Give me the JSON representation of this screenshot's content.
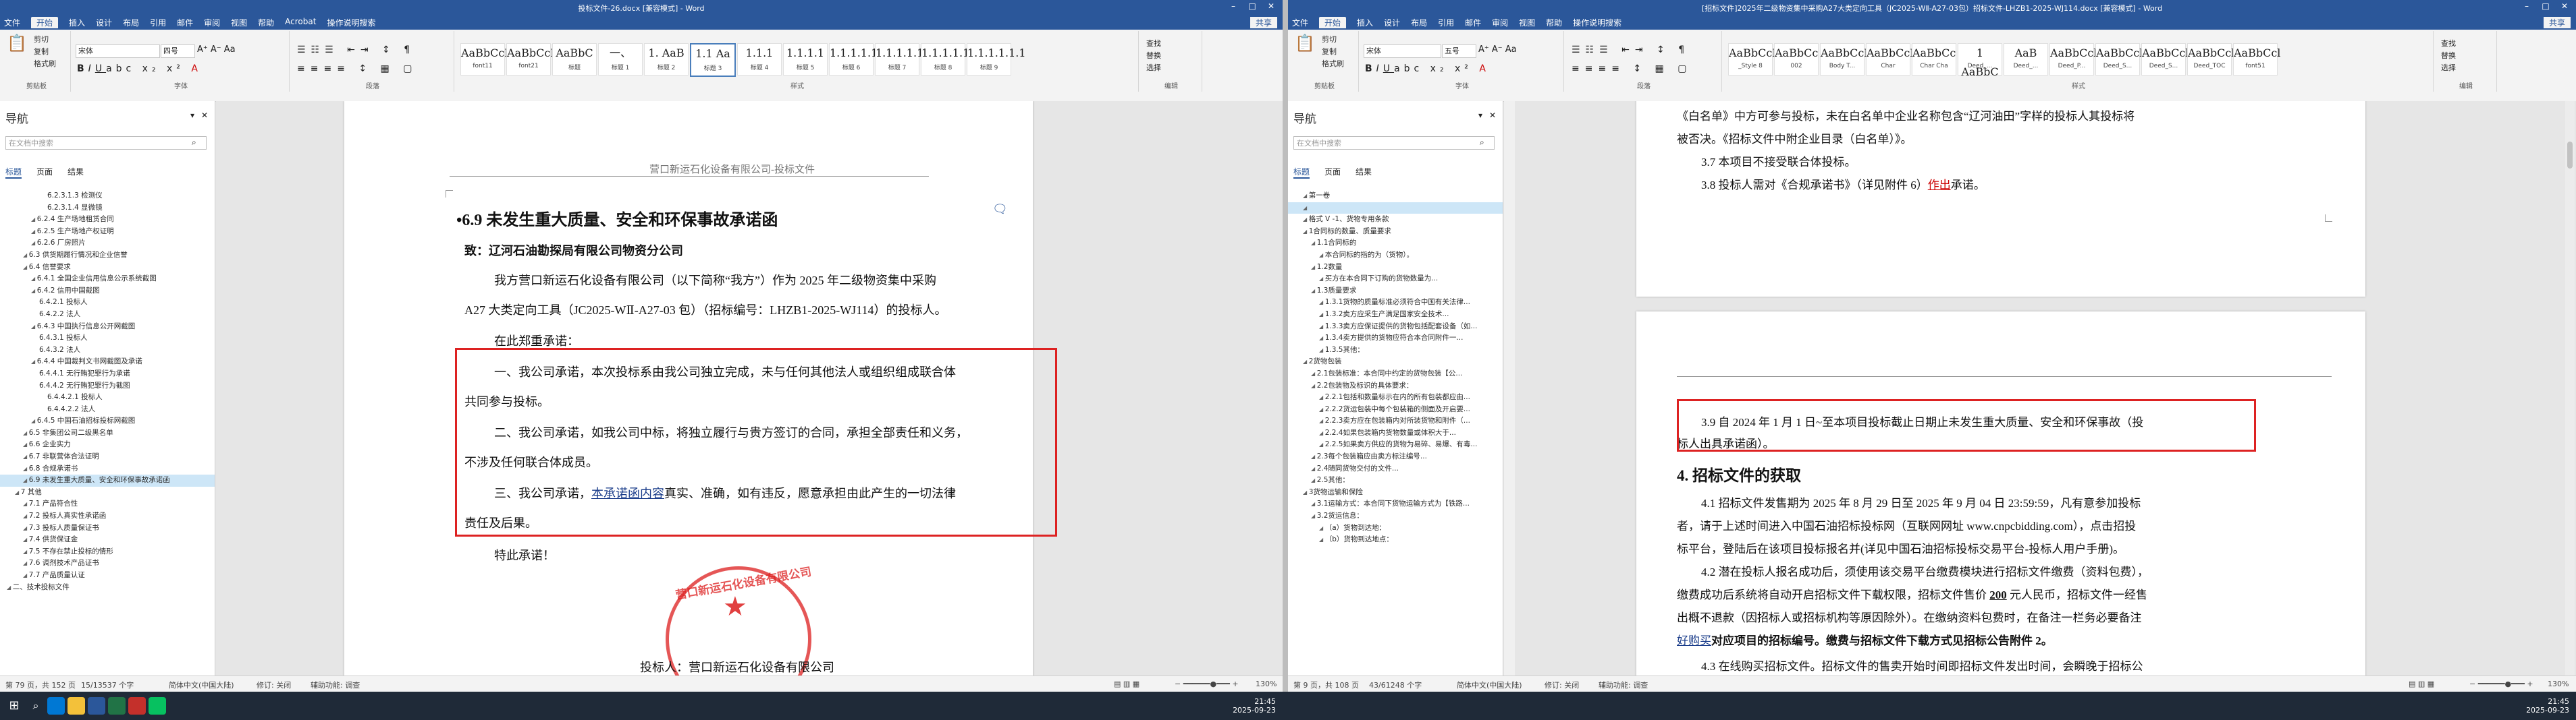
{
  "left": {
    "title": "投标文件-26.docx [兼容模式] - Word",
    "menu_tabs": [
      "文件",
      "开始",
      "插入",
      "设计",
      "布局",
      "引用",
      "邮件",
      "审阅",
      "视图",
      "帮助",
      "Acrobat",
      "操作说明搜索"
    ],
    "active_tab": "开始",
    "share_label": "共享",
    "quick_left": [
      "剪切",
      "复制",
      "格式刷"
    ],
    "font_name": "宋体",
    "font_size": "四号",
    "ribbon_groups": [
      "剪贴板",
      "字体",
      "段落",
      "样式",
      "编辑"
    ],
    "styles": [
      {
        "preview": "AaBbCcDd",
        "name": "font11"
      },
      {
        "preview": "AaBbCcDd",
        "name": "font21"
      },
      {
        "preview": "AaBbC",
        "name": "标题"
      },
      {
        "preview": "一、",
        "name": "标题 1"
      },
      {
        "preview": "1. AaB",
        "name": "标题 2"
      },
      {
        "preview": "1.1 Aa",
        "name": "标题 3"
      },
      {
        "preview": "1.1.1",
        "name": "标题 4"
      },
      {
        "preview": "1.1.1.1",
        "name": "标题 5"
      },
      {
        "preview": "1.1.1.1.1",
        "name": "标题 6"
      },
      {
        "preview": "1.1.1.1.1.",
        "name": "标题 7"
      },
      {
        "preview": "1.1.1.1.1.1",
        "name": "标题 8"
      },
      {
        "preview": "1.1.1.1.1.1",
        "name": "标题 9"
      }
    ],
    "edit_items": [
      "查找",
      "替换",
      "选择"
    ],
    "nav_title": "导航",
    "nav_search_placeholder": "在文档中搜索",
    "nav_tabs": [
      "标题",
      "页面",
      "结果"
    ],
    "nav_items": [
      {
        "label": "6.2.3.1.3 检测仪",
        "indent": 5
      },
      {
        "label": "6.2.3.1.4 显微镜",
        "indent": 5
      },
      {
        "label": "6.2.4 生产场地租赁合同",
        "indent": 3
      },
      {
        "label": "6.2.5 生产场地产权证明",
        "indent": 3
      },
      {
        "label": "6.2.6 厂房照片",
        "indent": 3
      },
      {
        "label": "6.3 供货期履行情况和企业信誉",
        "indent": 2
      },
      {
        "label": "6.4 信誉要求",
        "indent": 2
      },
      {
        "label": "6.4.1 全国企业信用信息公示系统截图",
        "indent": 3
      },
      {
        "label": "6.4.2 信用中国截图",
        "indent": 3
      },
      {
        "label": "6.4.2.1 投标人",
        "indent": 4
      },
      {
        "label": "6.4.2.2 法人",
        "indent": 4
      },
      {
        "label": "6.4.3 中国执行信息公开网截图",
        "indent": 3
      },
      {
        "label": "6.4.3.1 投标人",
        "indent": 4
      },
      {
        "label": "6.4.3.2 法人",
        "indent": 4
      },
      {
        "label": "6.4.4 中国裁判文书网截图及承诺",
        "indent": 3
      },
      {
        "label": "6.4.4.1 无行贿犯罪行为承诺",
        "indent": 4
      },
      {
        "label": "6.4.4.2 无行贿犯罪行为截图",
        "indent": 4
      },
      {
        "label": "6.4.4.2.1 投标人",
        "indent": 5
      },
      {
        "label": "6.4.4.2.2 法人",
        "indent": 5
      },
      {
        "label": "6.4.5 中国石油招标投标网截图",
        "indent": 3
      },
      {
        "label": "6.5 非集团公司二级黑名单",
        "indent": 2
      },
      {
        "label": "6.6 企业实力",
        "indent": 2
      },
      {
        "label": "6.7 非联营体合法证明",
        "indent": 2
      },
      {
        "label": "6.8 合规承诺书",
        "indent": 2
      },
      {
        "label": "6.9 未发生重大质量、安全和环保事故承诺函",
        "indent": 2,
        "selected": true
      },
      {
        "label": "7 其他",
        "indent": 1
      },
      {
        "label": "7.1 产品符合性",
        "indent": 2
      },
      {
        "label": "7.2 投标人真实性承诺函",
        "indent": 2
      },
      {
        "label": "7.3 投标人质量保证书",
        "indent": 2
      },
      {
        "label": "7.4 供货保证金",
        "indent": 2
      },
      {
        "label": "7.5 不存在禁止投标的情形",
        "indent": 2
      },
      {
        "label": "7.6 调剂技术产品证书",
        "indent": 2
      },
      {
        "label": "7.7 产品质量认证",
        "indent": 2
      },
      {
        "label": "二、技术投标文件",
        "indent": 0
      }
    ],
    "doc": {
      "header": "营口新运石化设备有限公司-投标文件",
      "heading": "•6.9    未发生重大质量、安全和环保事故承诺函",
      "to": "致：辽河石油勘探局有限公司物资分公司",
      "p1a": "我方营口新运石化设备有限公司（以下简称“我方”）作为 2025 年二级物资集中采购",
      "p1b": "A27 大类定向工具（JC2025-WⅡ-A27-03 包）（招标编号：LHZB1-2025-WJ114）的投标人。",
      "p2": "在此郑重承诺：",
      "c1a": "一、我公司承诺，本次投标系由我公司独立完成，未与任何其他法人或组织组成联合体",
      "c1b": "共同参与投标。",
      "c2a": "二、我公司承诺，如我公司中标，将独立履行与贵方签订的合同，承担全部责任和义务，",
      "c2b": "不涉及任何联合体成员。",
      "c3a_pre": "三、我公司承诺，",
      "c3a_ul": "本承诺函内容",
      "c3a_post": "真实、准确，如有违反，愿意承担由此产生的一切法律",
      "c3b": "责任及后果。",
      "end": "特此承诺！",
      "sig": "投标人：营口新运石化设备有限公司",
      "seal_text": "营口新运石化设备有限公司"
    },
    "status": {
      "page": "第 79 页，共 152 页",
      "words": "15/13537 个字",
      "lang": "简体中文(中国大陆)",
      "track": "修订: 关闭",
      "access": "辅助功能: 调查",
      "zoom": "130%"
    }
  },
  "right": {
    "title": "[招标文件]2025年二级物资集中采购A27大类定向工具（JC2025-WⅡ-A27-03包）招标文件-LHZB1-2025-WJ114.docx [兼容模式] - Word",
    "menu_tabs": [
      "文件",
      "开始",
      "插入",
      "设计",
      "布局",
      "引用",
      "邮件",
      "审阅",
      "视图",
      "帮助",
      "操作说明搜索"
    ],
    "active_tab": "开始",
    "share_label": "共享",
    "font_name": "宋体",
    "font_size": "五号",
    "ribbon_groups": [
      "剪贴板",
      "字体",
      "段落",
      "样式",
      "编辑"
    ],
    "styles": [
      {
        "preview": "AaBbCcI",
        "name": "_Style 8"
      },
      {
        "preview": "AaBbCc",
        "name": "002"
      },
      {
        "preview": "AaBbCcL",
        "name": "Body T..."
      },
      {
        "preview": "AaBbCcI",
        "name": "Char"
      },
      {
        "preview": "AaBbCc",
        "name": "Char Cha"
      },
      {
        "preview": "1 AaBbC",
        "name": "Deed_..."
      },
      {
        "preview": "AaB",
        "name": "Deed_..."
      },
      {
        "preview": "AaBbCcl",
        "name": "Deed_P..."
      },
      {
        "preview": "AaBbCcl",
        "name": "Deed_S..."
      },
      {
        "preview": "AaBbCcl",
        "name": "Deed_S..."
      },
      {
        "preview": "AaBbCcl",
        "name": "Deed_TOC"
      },
      {
        "preview": "AaBbCcl",
        "name": "font51"
      }
    ],
    "edit_items": [
      "查找",
      "替换",
      "选择"
    ],
    "nav_title": "导航",
    "nav_search_placeholder": "在文档中搜索",
    "nav_tabs": [
      "标题",
      "页面",
      "结果"
    ],
    "nav_items": [
      {
        "label": "第一卷",
        "indent": 1
      },
      {
        "label": "",
        "indent": 1,
        "selected": true
      },
      {
        "label": "格式 V -1、货物专用条款",
        "indent": 1
      },
      {
        "label": "1合同标的数量、质量要求",
        "indent": 1
      },
      {
        "label": "1.1合同标的",
        "indent": 2
      },
      {
        "label": "本合同标的指的为（货物）。",
        "indent": 3
      },
      {
        "label": "1.2数量",
        "indent": 2
      },
      {
        "label": "买方在本合同下订购的货物数量为...",
        "indent": 3
      },
      {
        "label": "1.3质量要求",
        "indent": 2
      },
      {
        "label": "1.3.1货物的质量标准必须符合中国有关法律...",
        "indent": 3
      },
      {
        "label": "1.3.2卖方应采生产满足国家安全技术...",
        "indent": 3
      },
      {
        "label": "1.3.3卖方应保证提供的货物包括配套设备（如...",
        "indent": 3
      },
      {
        "label": "1.3.4卖方提供的货物应符合本合同附件一...",
        "indent": 3
      },
      {
        "label": "1.3.5其他：",
        "indent": 3
      },
      {
        "label": "2货物包装",
        "indent": 1
      },
      {
        "label": "2.1包装标准：本合同中约定的货物包装【公...",
        "indent": 2
      },
      {
        "label": "2.2包装物及标识的具体要求：",
        "indent": 2
      },
      {
        "label": "2.2.1包括和数量标示在内的所有包装都应由...",
        "indent": 3
      },
      {
        "label": "2.2.2货运包装中每个包装箱的侧面及开启要...",
        "indent": 3
      },
      {
        "label": "2.2.3卖方应在包装箱内对所装货物和附件（...",
        "indent": 3
      },
      {
        "label": "2.2.4如果包装箱内货物数量或体积大于...",
        "indent": 3
      },
      {
        "label": "2.2.5如果卖方供应的货物为易碎、易爆、有毒...",
        "indent": 3
      },
      {
        "label": "2.3每个包装箱应由卖方标注编号...",
        "indent": 2
      },
      {
        "label": "2.4随同货物交付的文件...",
        "indent": 2
      },
      {
        "label": "2.5其他：",
        "indent": 2
      },
      {
        "label": "3货物运输和保险",
        "indent": 1
      },
      {
        "label": "3.1运输方式：本合同下货物运输方式为【铁路...",
        "indent": 2
      },
      {
        "label": "3.2货运信息：",
        "indent": 2
      },
      {
        "label": "（a）货物到达地：",
        "indent": 3
      },
      {
        "label": "（b）货物到达地点：",
        "indent": 3
      }
    ],
    "doc": {
      "p_a": "《白名单》中方可参与投标，未在白名单中企业名称包含“辽河油田”字样的投标人其投标将",
      "p_b": "被否决。《招标文件中附企业目录（白名单）》。",
      "p_37": "3.7 本项目不接受联合体投标。",
      "p_38_pre": "3.8 投标人需对《合规承诺书》（详见附件 6）",
      "p_38_ul": "作出",
      "p_38_post": "承诺。",
      "p_39a": "3.9 自 2024 年 1 月 1 日~至本项目投标截止日期止未发生重大质量、安全和环保事故（投",
      "p_39b": "标人出具承诺函）。",
      "h4": "4. 招标文件的获取",
      "p_41a": "4.1 招标文件发售期为 2025 年 8 月 29 日至 2025 年 9 月 04 日 23:59:59，凡有意参加投标",
      "p_41b": "者，请于上述时间进入中国石油招标投标网（互联网网址 www.cnpcbidding.com），点击招投",
      "p_41c": "标平台，登陆后在该项目投标报名并(详见中国石油招标投标交易平台-投标人用户手册)。",
      "p_42a": "4.2 潜在投标人报名成功后，须使用该交易平台缴费模块进行招标文件缴费（资料包费），",
      "p_42b_pre": "缴费成功后系统将自动开启招标文件下载权限，招标文件售价 ",
      "p_42b_bold": "200",
      "p_42b_post": " 元人民币，招标文件一经售",
      "p_42c": "出概不退款（因招标人或招标机构等原因除外）。在缴纳资料包费时，在备注一栏务必要备注",
      "p_42d_ul": "好购买",
      "p_42d_post": "对应项目的招标编号。缴费与招标文件下载方式见招标公告附件 2。",
      "p_43a": "4.3 在线购买招标文件。招标文件的售卖开始时间即招标文件发出时间，会瞬晚于招标公"
    },
    "status": {
      "page": "第 9 页，共 108 页",
      "words": "43/61248 个字",
      "lang": "简体中文(中国大陆)",
      "track": "修订: 关闭",
      "access": "辅助功能: 调查",
      "zoom": "130%"
    }
  },
  "taskbar": {
    "time_left": "21:45",
    "date_left": "2025-09-23",
    "time_right": "21:45",
    "date_right": "2025-09-23"
  }
}
